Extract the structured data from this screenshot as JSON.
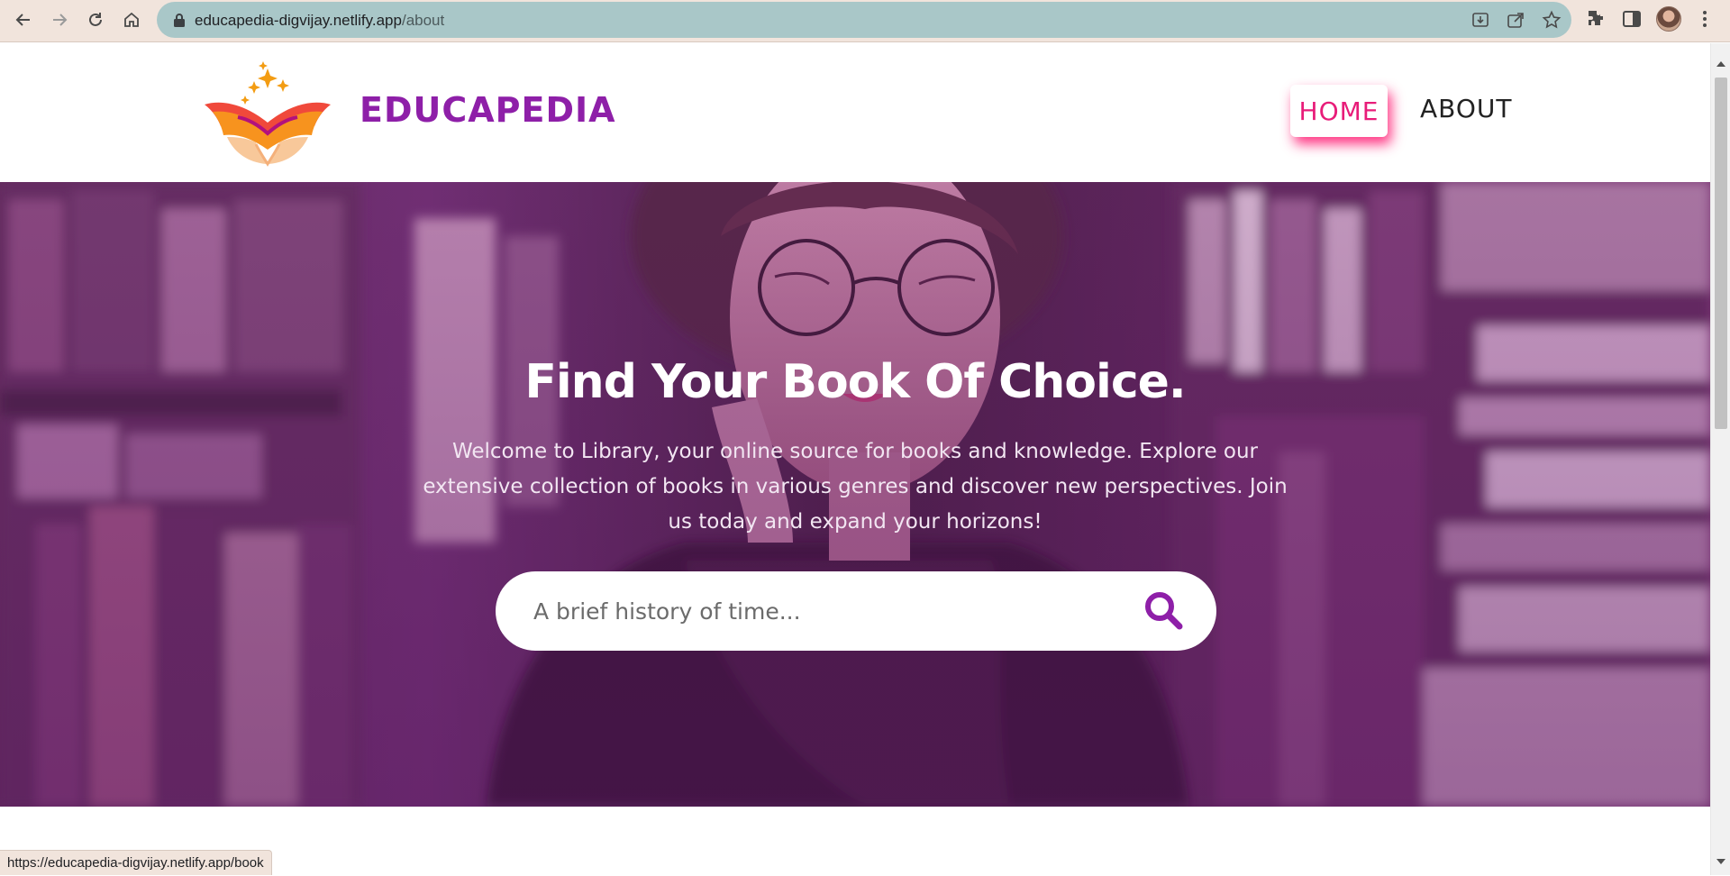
{
  "browser": {
    "url_host": "educapedia-digvijay.netlify.app",
    "url_path": "/about",
    "status_url": "https://educapedia-digvijay.netlify.app/book"
  },
  "site": {
    "brand": "EDUCAPEDIA",
    "nav": {
      "home": "HOME",
      "about": "ABOUT"
    }
  },
  "hero": {
    "title": "Find Your Book Of Choice.",
    "description": "Welcome to Library, your online source for books and knowledge. Explore our extensive collection of books in various genres and discover new perspectives. Join us today and expand your horizons!",
    "search_placeholder": "A brief history of time..."
  },
  "colors": {
    "brand": "#8e1fa8",
    "nav_active": "#e81c79",
    "search_icon": "#8e1fa8"
  }
}
